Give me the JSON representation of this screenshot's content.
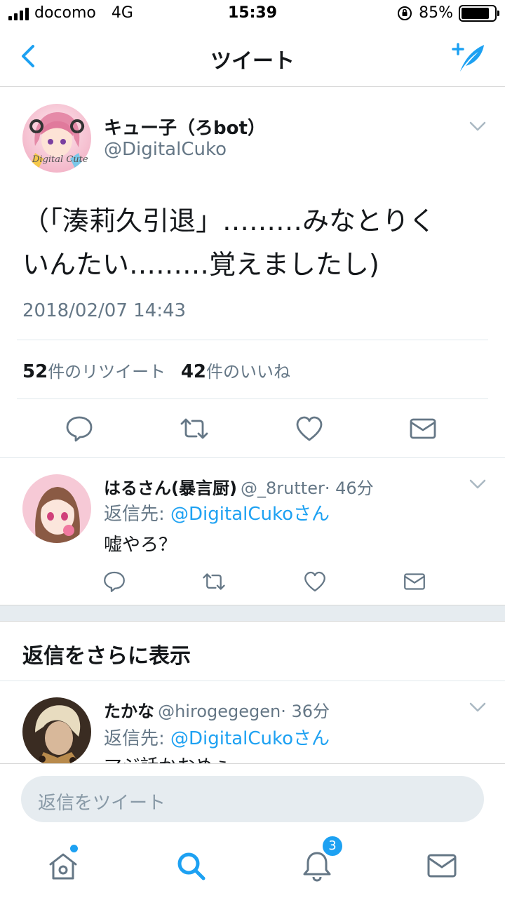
{
  "status_bar": {
    "carrier": "docomo",
    "network": "4G",
    "time": "15:39",
    "battery_text": "85%",
    "battery_level": 0.85
  },
  "nav": {
    "title": "ツイート",
    "back_icon": "chevron-left-icon",
    "compose_icon": "compose-tweet-icon"
  },
  "main_tweet": {
    "display_name": "キュー子（ろbot）",
    "handle": "@DigitalCuko",
    "avatar_caption": "Digital Cute",
    "text_line1": "（「湊莉久引退」………みなとりく",
    "text_line2": "いんたい………覚えましたし)",
    "timestamp": "2018/02/07 14:43",
    "retweet_count": "52",
    "retweet_label": "件のリツイート",
    "like_count": "42",
    "like_label": "件のいいね"
  },
  "replies": [
    {
      "display_name": "はるさん(暴言厨)",
      "handle": "@_8rutter",
      "time": "· 46分",
      "reply_to_label": "返信先: ",
      "reply_to_mention": "@DigitalCukoさん",
      "text": "嘘やろ？"
    },
    {
      "display_name": "たかな",
      "handle": "@hirogegegen",
      "time": "· 36分",
      "reply_to_label": "返信先: ",
      "reply_to_mention": "@DigitalCukoさん",
      "text": "マジ話かおめぇ"
    }
  ],
  "more_replies_label": "返信をさらに表示",
  "reply_input": {
    "placeholder": "返信をツイート"
  },
  "tab_bar": {
    "notifications_badge": "3"
  },
  "colors": {
    "accent": "#1da1f2",
    "secondary_text": "#657786",
    "divider": "#e1e8ed"
  }
}
